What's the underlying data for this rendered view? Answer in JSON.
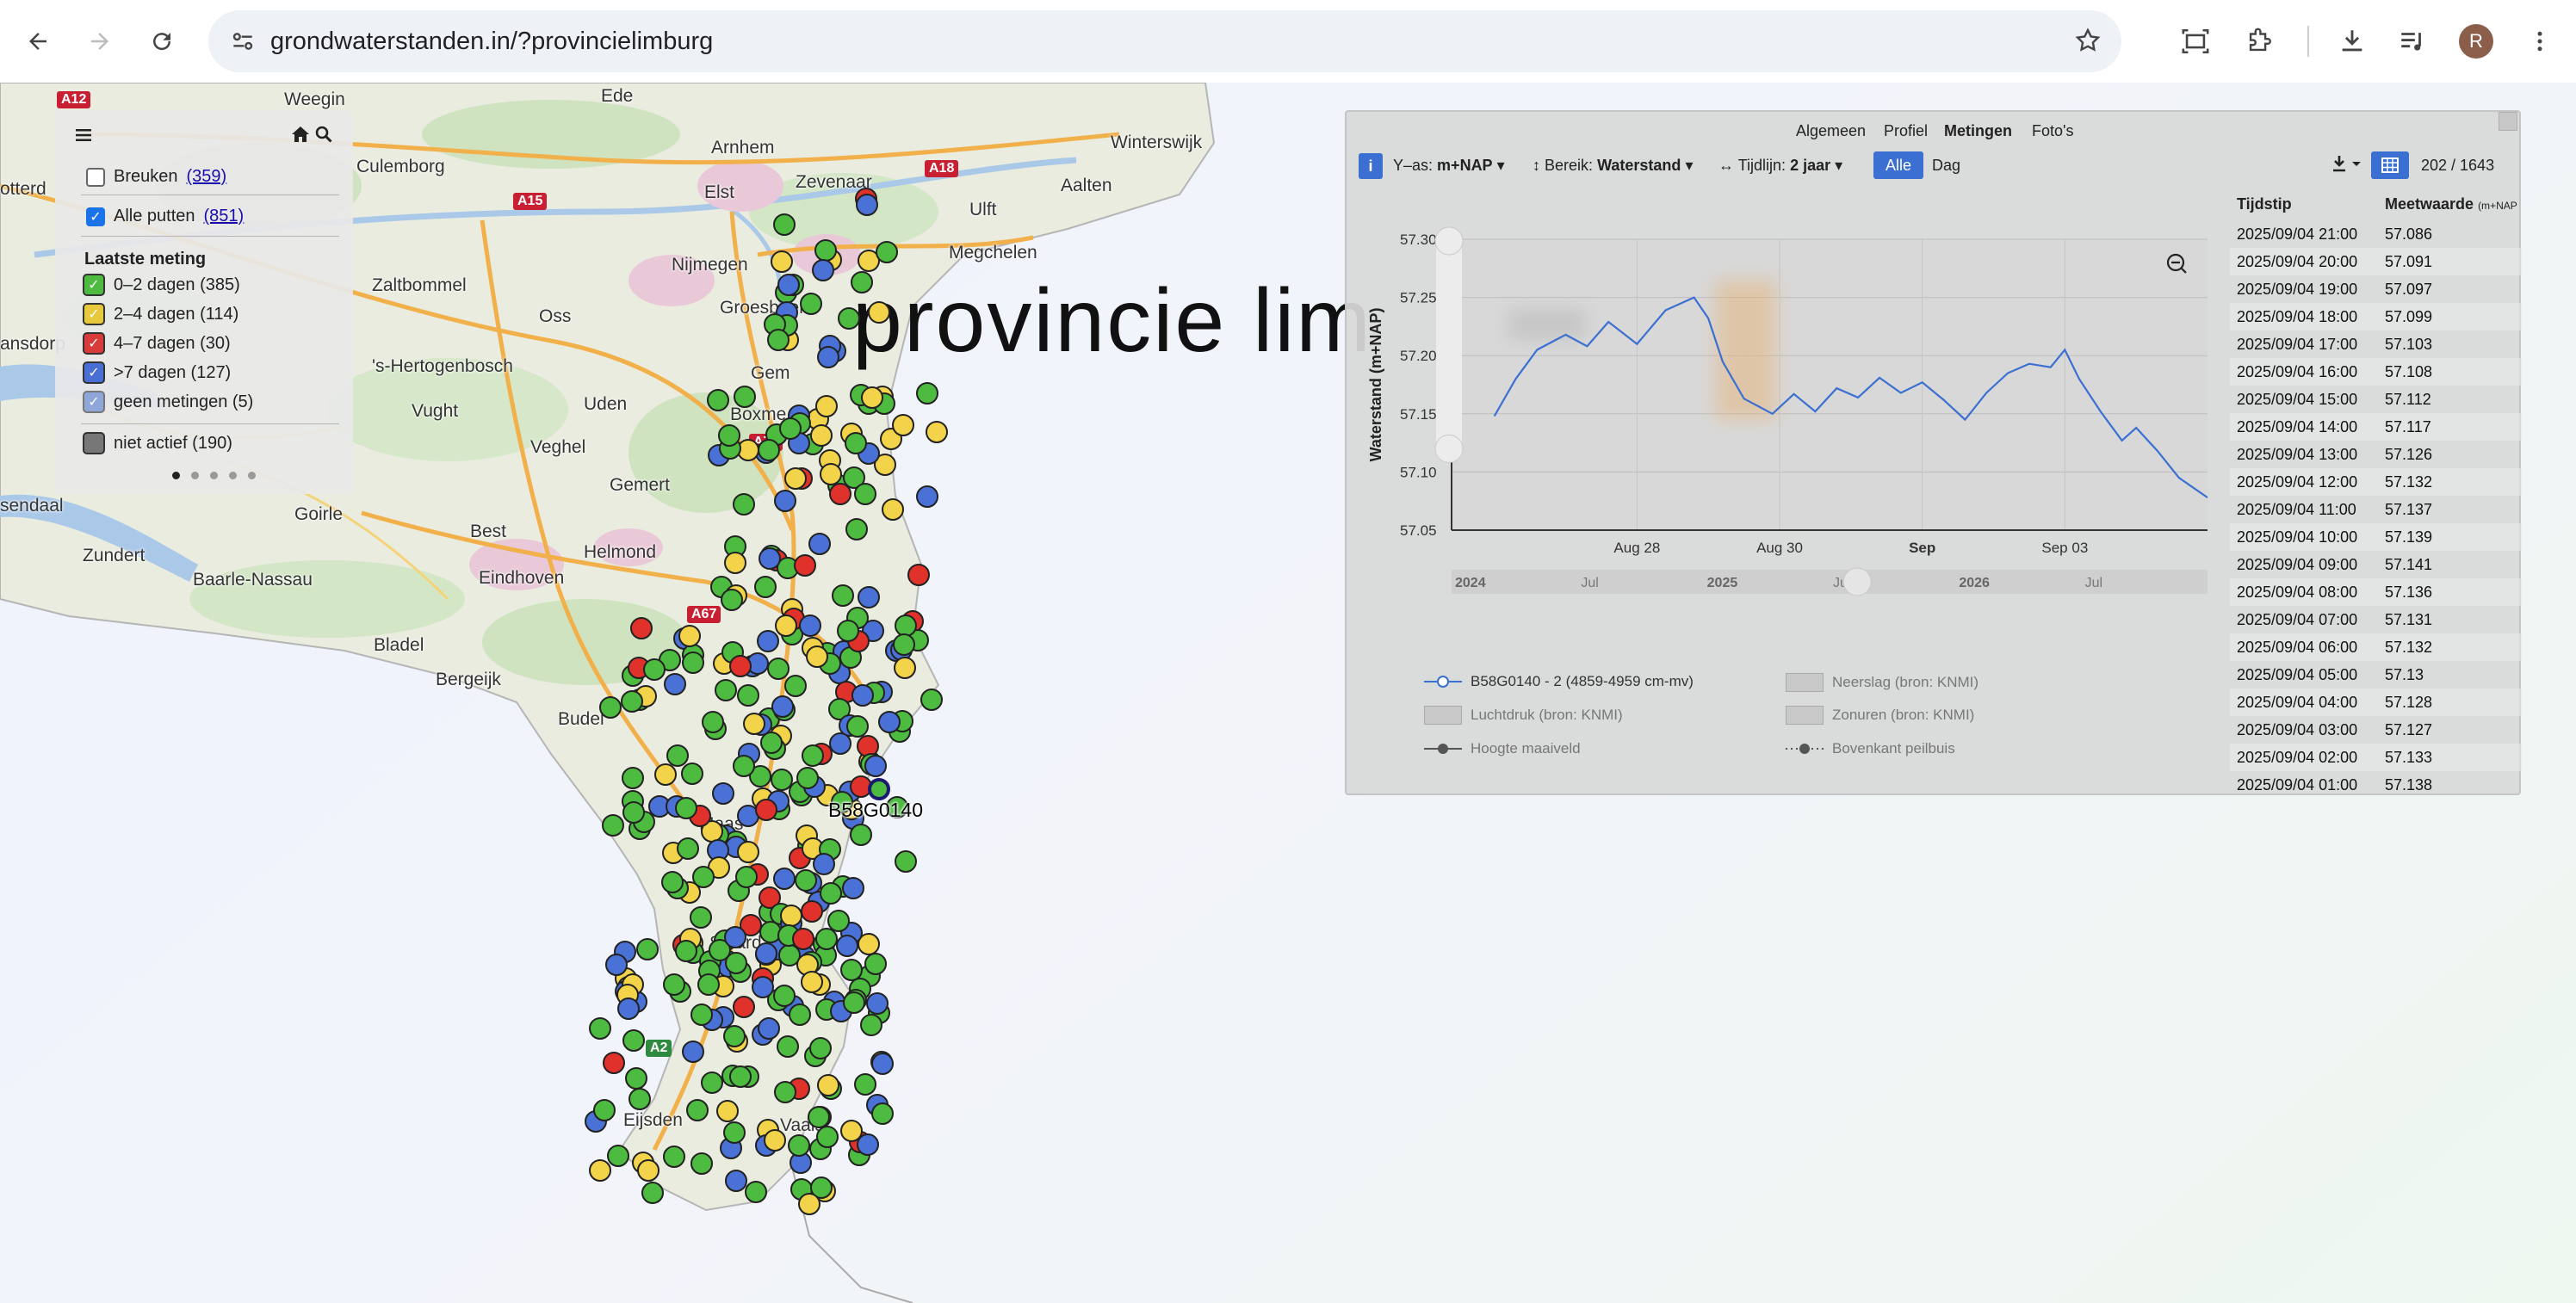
{
  "browser": {
    "url": "grondwaterstanden.in/?provincielimburg",
    "avatar_letter": "R"
  },
  "map": {
    "title_overlay": "provincie lim",
    "selected_well_label": "B58G0140",
    "places": [
      "Weegin",
      "Ede",
      "Arnhem",
      "Winterswijk",
      "Culemborg",
      "Zevenaar",
      "Aalten",
      "Elst",
      "Ulft",
      "Nijmegen",
      "Megchelen",
      "Zaltbommel",
      "Groesbeek",
      "Oss",
      "Gem",
      "'s-Hertogenbosch",
      "Boxme",
      "Vught",
      "Uden",
      "Veghel",
      "Gemert",
      "sendaal",
      "Goirle",
      "Best",
      "Helmond",
      "Zundert",
      "Baarle-Nassau",
      "Eindhoven",
      "Bladel",
      "Bergeijk",
      "Budel",
      "Maas",
      "Sittard",
      "Eijsden",
      "Vaals",
      "otterd",
      "ansdorp"
    ],
    "roads": [
      "A12",
      "A15",
      "A18",
      "A73",
      "A67",
      "A2"
    ],
    "well_counts": {
      "green": 385,
      "yellow": 114,
      "red": 30,
      "blue": 127
    }
  },
  "legend": {
    "breuken_label": "Breuken",
    "breuken_count": "(359)",
    "alle_putten_label": "Alle putten",
    "alle_putten_count": "(851)",
    "laatste_meting_title": "Laatste meting",
    "items": [
      {
        "label": "0–2 dagen (385)",
        "color": "#4cbb3f"
      },
      {
        "label": "2–4 dagen (114)",
        "color": "#e8c93c"
      },
      {
        "label": "4–7 dagen (30)",
        "color": "#d93a3a"
      },
      {
        "label": ">7 dagen (127)",
        "color": "#4a6fd4"
      },
      {
        "label": "geen metingen (5)",
        "color": "#8fa6d8"
      }
    ],
    "niet_actief_label": "niet actief (190)"
  },
  "panel": {
    "tabs": [
      "Algemeen",
      "Profiel",
      "Metingen",
      "Foto's"
    ],
    "active_tab": "Metingen",
    "info_btn": "i",
    "yas_label": "Y–as:",
    "yas_value": "m+NAP",
    "bereik_label": "Bereik:",
    "bereik_value": "Waterstand",
    "tijdlijn_label": "Tijdlijn:",
    "tijdlijn_value": "2 jaar",
    "alle_btn": "Alle",
    "dag_btn": "Dag",
    "count": "202 / 1643"
  },
  "chart_data": {
    "type": "line",
    "ylabel": "Waterstand (m+NAP)",
    "ylim": [
      57.05,
      57.3
    ],
    "yticks": [
      "57.30",
      "57.25",
      "57.20",
      "57.15",
      "57.10",
      "57.05"
    ],
    "xticks": [
      {
        "label": "Aug 28",
        "bold": false
      },
      {
        "label": "Aug 30",
        "bold": false
      },
      {
        "label": "Sep",
        "bold": true
      },
      {
        "label": "Sep 03",
        "bold": false
      }
    ],
    "navigator_ticks": [
      {
        "label": "2024",
        "bold": true
      },
      {
        "label": "Jul",
        "bold": false
      },
      {
        "label": "2025",
        "bold": true
      },
      {
        "label": "Jul",
        "bold": false
      },
      {
        "label": "2026",
        "bold": true
      },
      {
        "label": "Jul",
        "bold": false
      }
    ],
    "series": [
      {
        "name": "B58G0140 - 2 (4859-4959 cm-mv)",
        "color": "#3b6fd1",
        "x": [
          26.0,
          26.3,
          26.6,
          27.0,
          27.3,
          27.6,
          28.0,
          28.4,
          28.8,
          29.0,
          29.2,
          29.5,
          29.9,
          30.2,
          30.5,
          30.8,
          31.1,
          31.4,
          31.7,
          32.0,
          32.3,
          32.6,
          32.9,
          33.2,
          33.5,
          33.8,
          34.0,
          34.2,
          34.5,
          34.8,
          35.0,
          35.3,
          35.6,
          36.0
        ],
        "values": [
          57.148,
          57.18,
          57.205,
          57.218,
          57.208,
          57.229,
          57.21,
          57.239,
          57.25,
          57.232,
          57.195,
          57.163,
          57.15,
          57.167,
          57.152,
          57.172,
          57.164,
          57.181,
          57.168,
          57.177,
          57.162,
          57.145,
          57.168,
          57.185,
          57.193,
          57.19,
          57.205,
          57.18,
          57.152,
          57.127,
          57.138,
          57.118,
          57.095,
          57.078
        ]
      }
    ],
    "legend_items": [
      {
        "label": "B58G0140 - 2 (4859-4959 cm-mv)",
        "kind": "line"
      },
      {
        "label": "Neerslag (bron: KNMI)",
        "kind": "box"
      },
      {
        "label": "Luchtdruk (bron: KNMI)",
        "kind": "box"
      },
      {
        "label": "Zonuren (bron: KNMI)",
        "kind": "box"
      },
      {
        "label": "Hoogte maaiveld",
        "kind": "marker"
      },
      {
        "label": "Bovenkant peilbuis",
        "kind": "dotted"
      }
    ]
  },
  "table": {
    "col_time": "Tijdstip",
    "col_value": "Meetwaarde",
    "col_unit": "(m+NAP",
    "rows": [
      [
        "2025/09/04 21:00",
        "57.086"
      ],
      [
        "2025/09/04 20:00",
        "57.091"
      ],
      [
        "2025/09/04 19:00",
        "57.097"
      ],
      [
        "2025/09/04 18:00",
        "57.099"
      ],
      [
        "2025/09/04 17:00",
        "57.103"
      ],
      [
        "2025/09/04 16:00",
        "57.108"
      ],
      [
        "2025/09/04 15:00",
        "57.112"
      ],
      [
        "2025/09/04 14:00",
        "57.117"
      ],
      [
        "2025/09/04 13:00",
        "57.126"
      ],
      [
        "2025/09/04 12:00",
        "57.132"
      ],
      [
        "2025/09/04 11:00",
        "57.137"
      ],
      [
        "2025/09/04 10:00",
        "57.139"
      ],
      [
        "2025/09/04 09:00",
        "57.141"
      ],
      [
        "2025/09/04 08:00",
        "57.136"
      ],
      [
        "2025/09/04 07:00",
        "57.131"
      ],
      [
        "2025/09/04 06:00",
        "57.132"
      ],
      [
        "2025/09/04 05:00",
        "57.13"
      ],
      [
        "2025/09/04 04:00",
        "57.128"
      ],
      [
        "2025/09/04 03:00",
        "57.127"
      ],
      [
        "2025/09/04 02:00",
        "57.133"
      ],
      [
        "2025/09/04 01:00",
        "57.138"
      ]
    ]
  }
}
